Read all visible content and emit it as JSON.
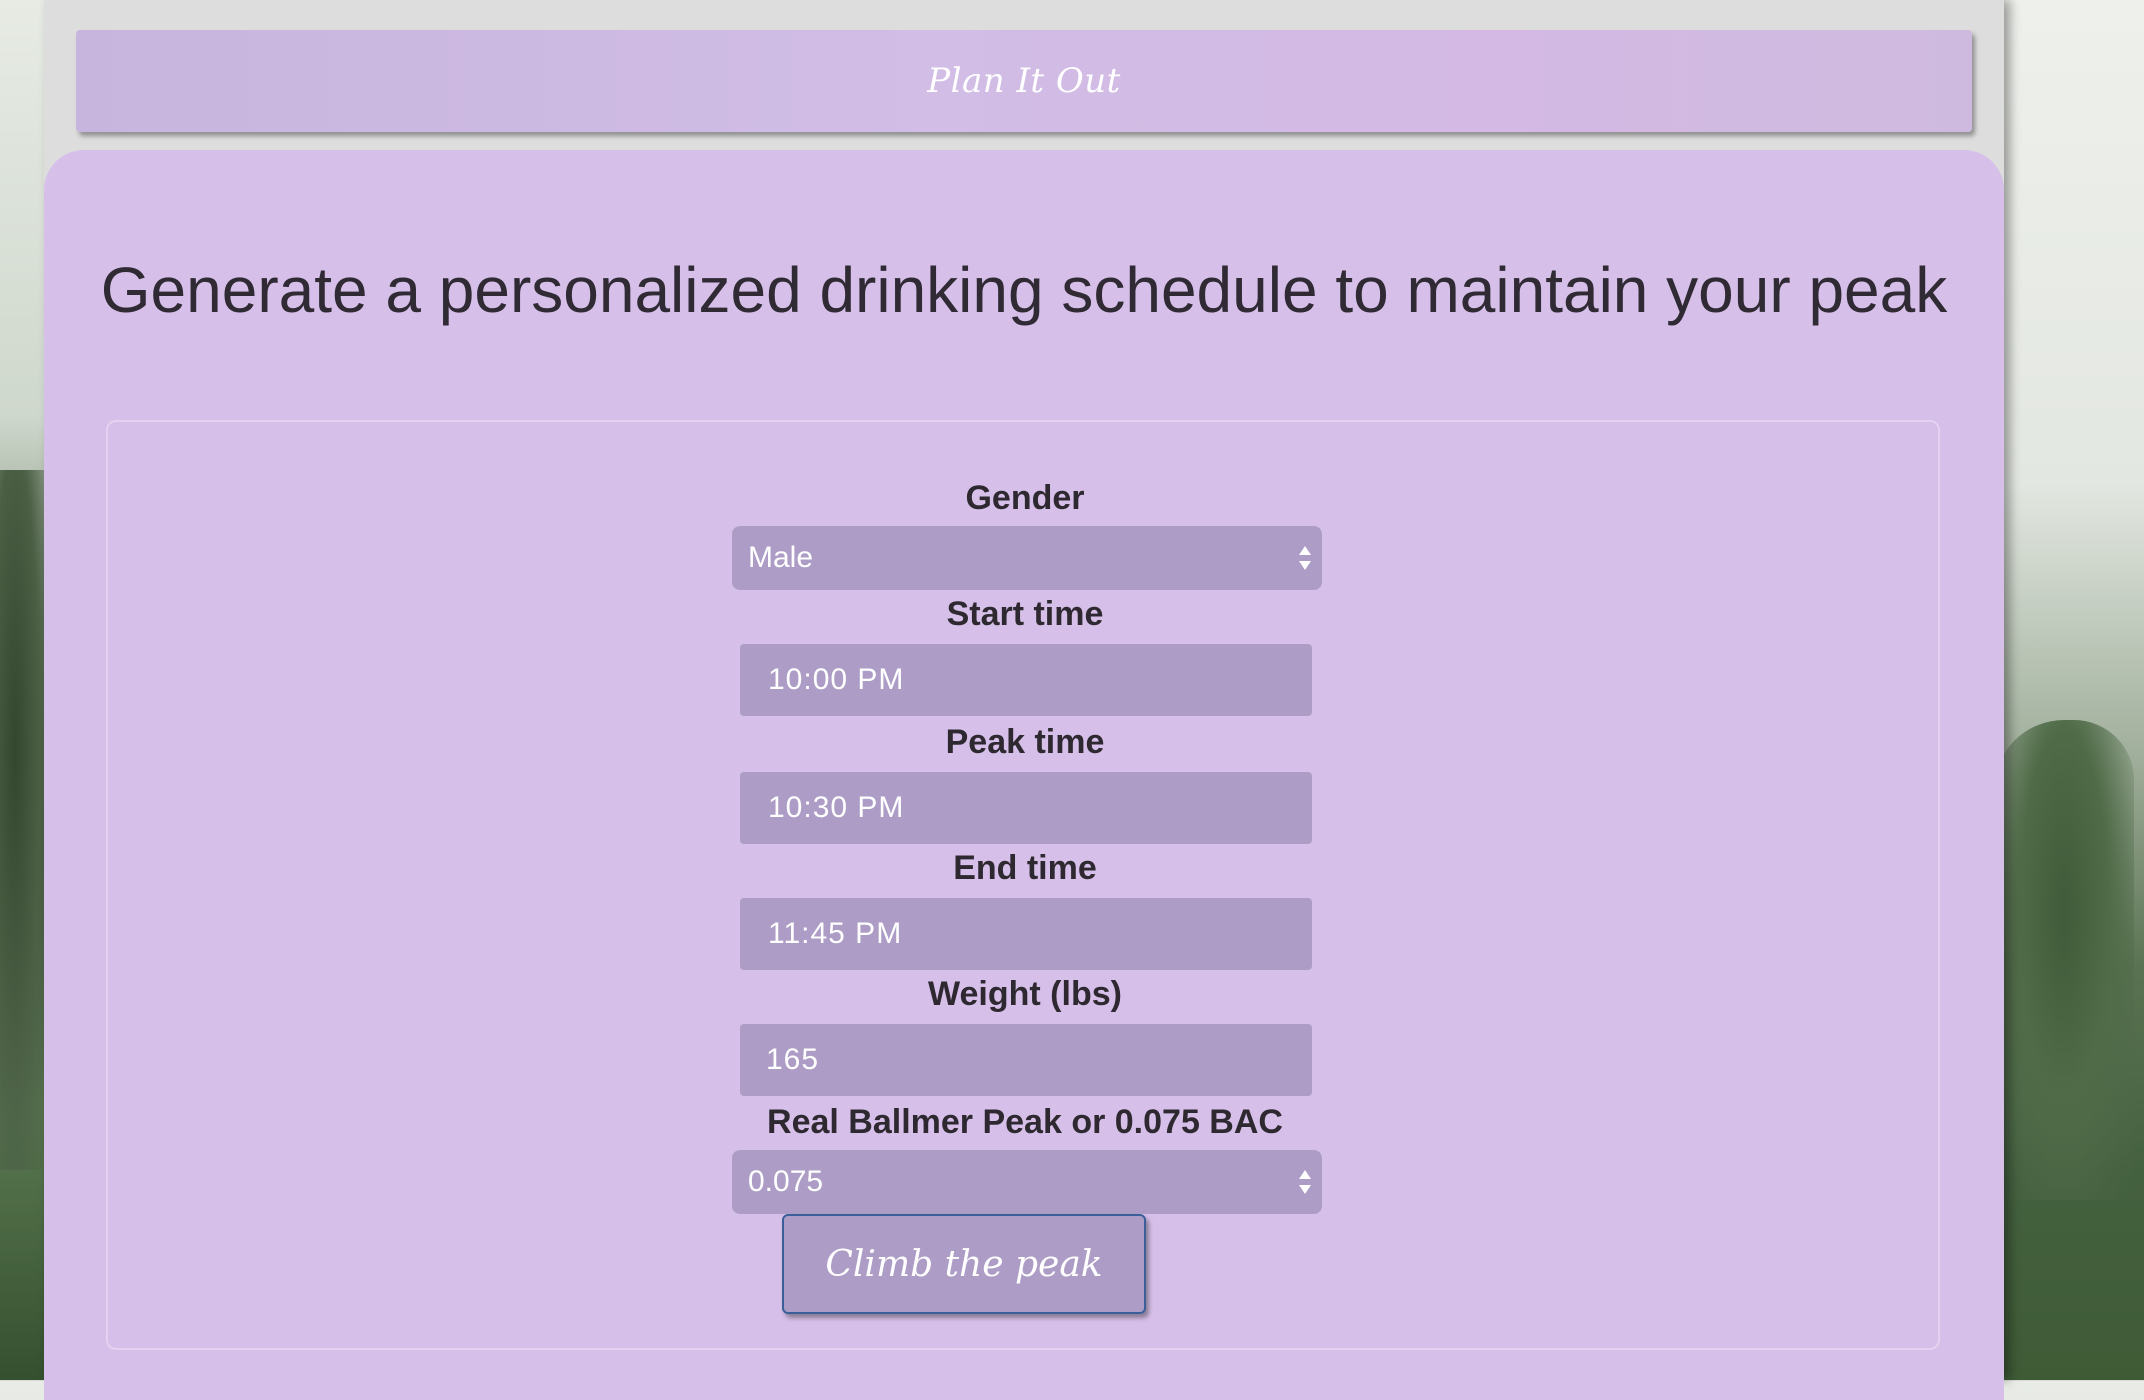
{
  "header": {
    "title": "Plan It Out"
  },
  "main": {
    "headline": "Generate a personalized drinking schedule to maintain your peak"
  },
  "form": {
    "gender": {
      "label": "Gender",
      "value": "Male",
      "icon": "select-arrows-icon"
    },
    "start_time": {
      "label": "Start time",
      "value": "10:00 PM"
    },
    "peak_time": {
      "label": "Peak time",
      "value": "10:30 PM"
    },
    "end_time": {
      "label": "End time",
      "value": "11:45 PM"
    },
    "weight": {
      "label": "Weight (lbs)",
      "value": "165"
    },
    "target": {
      "label": "Real Ballmer Peak or 0.075 BAC",
      "value": "0.075",
      "icon": "select-arrows-icon"
    },
    "submit_label": "Climb the peak"
  },
  "colors": {
    "panel": "#d6bfe8",
    "field": "#ad9dc6",
    "header_bar": "#cfbadf",
    "button_border": "#3a5f99",
    "text_dark": "#2e2930"
  }
}
